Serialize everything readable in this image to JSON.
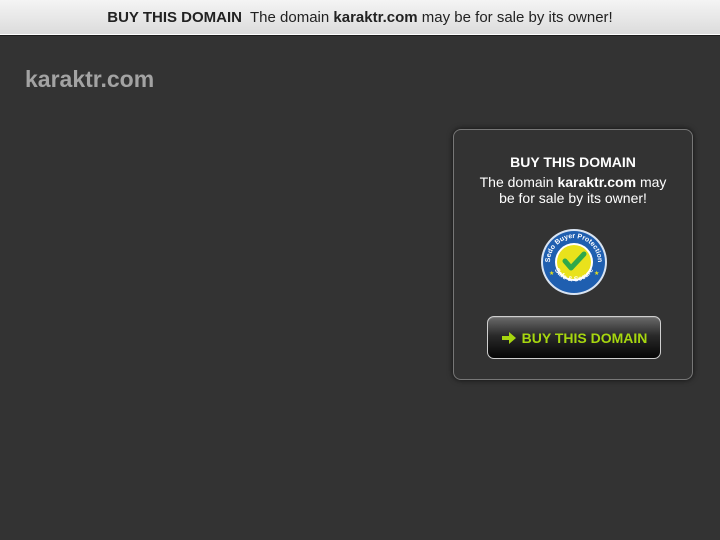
{
  "topbar": {
    "buy_label": "BUY THIS DOMAIN",
    "text_before": "The domain",
    "domain": "karaktr.com",
    "text_after": "may be for sale by its owner!"
  },
  "site": {
    "title": "karaktr.com"
  },
  "panel": {
    "heading": "BUY THIS DOMAIN",
    "text_before": "The domain",
    "domain": "karaktr.com",
    "text_after": "may be for sale by its owner!",
    "seal": {
      "icon": "sedo-buyer-protection-seal-icon",
      "top_text": "Sedo Buyer Protection",
      "bottom_text": "Safe & Secure"
    },
    "button_label": "BUY THIS DOMAIN",
    "button_icon": "arrow-right-icon"
  },
  "colors": {
    "background": "#333333",
    "topbar": "#e8e8e8",
    "title": "#a3a3a3",
    "button_text": "#a6d60f",
    "seal_blue": "#1f5fb0",
    "seal_yellow": "#e9e21c"
  }
}
